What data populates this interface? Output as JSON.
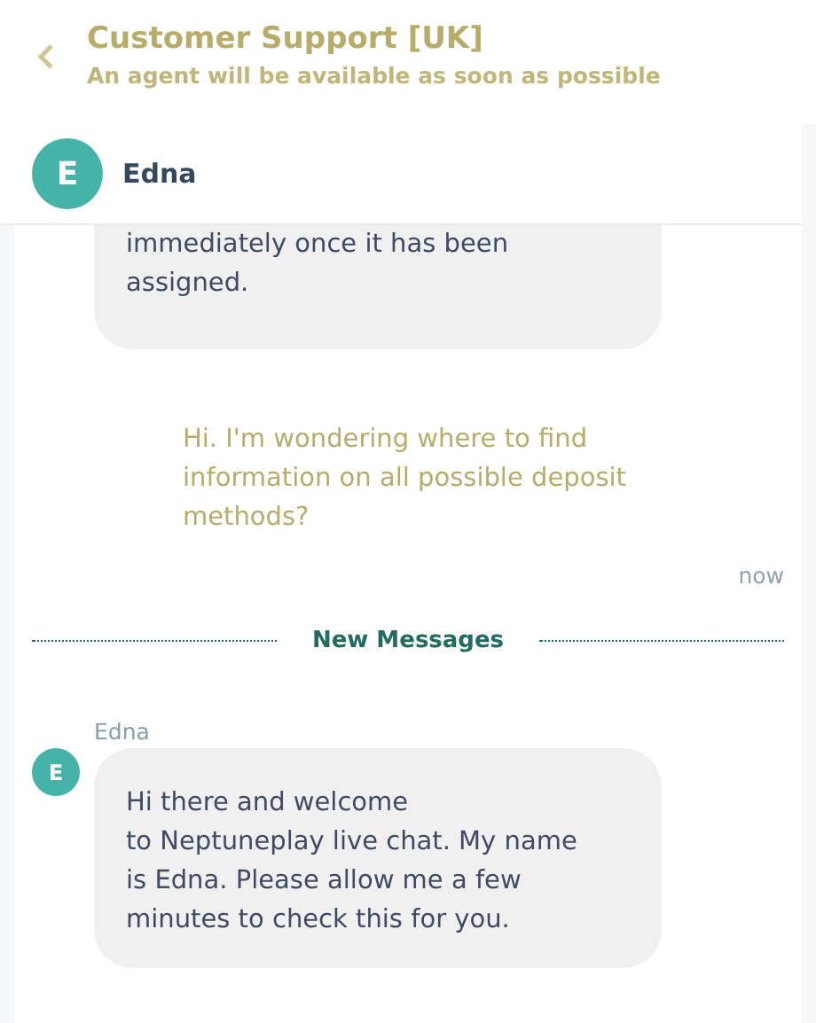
{
  "header": {
    "title": "Customer Support [UK]",
    "subtitle": "An agent will be available as soon as possible"
  },
  "agent": {
    "initial": "E",
    "name": "Edna"
  },
  "messages": [
    {
      "kind": "agent",
      "text": "immediately once it has been\nassigned."
    },
    {
      "kind": "user",
      "text": "Hi. I'm wondering where to find\ninformation on all possible deposit\nmethods?",
      "time": "now"
    },
    {
      "kind": "divider",
      "text": "New Messages"
    },
    {
      "kind": "agent",
      "sender": "Edna",
      "initial": "E",
      "text": "Hi there and welcome\nto Neptuneplay live chat. My name\nis Edna. Please allow me a few\nminutes to check this for you."
    }
  ]
}
